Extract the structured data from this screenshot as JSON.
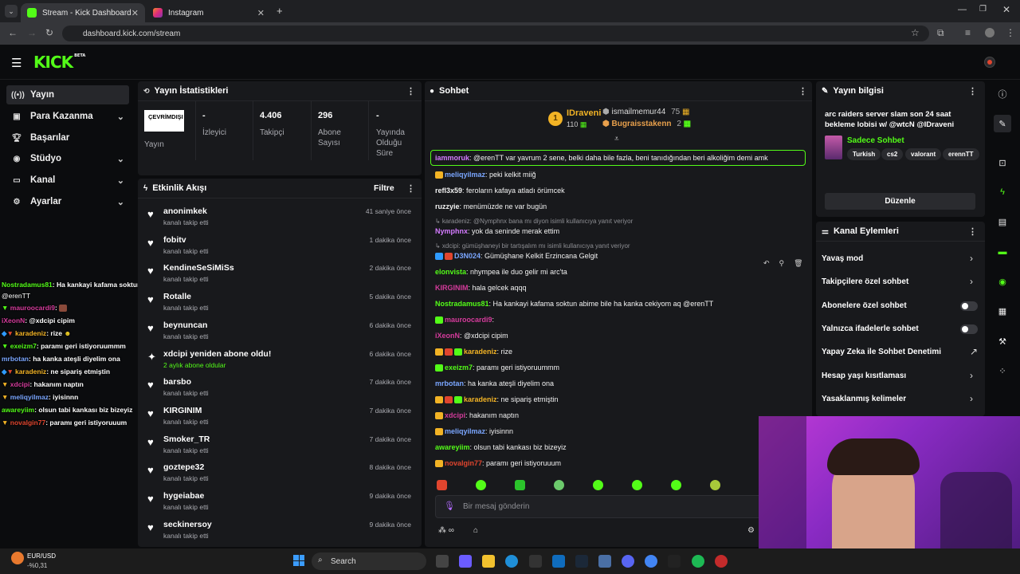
{
  "browser": {
    "tabs": [
      {
        "title": "Stream - Kick Dashboard",
        "fav_color": "#53fc18"
      },
      {
        "title": "Instagram",
        "fav_color": "#e1306c"
      }
    ],
    "url": "dashboard.kick.com/stream"
  },
  "app": {
    "logo": "KICK",
    "beta": "BETA"
  },
  "sidebar": {
    "items": [
      {
        "label": "Yayın",
        "icon": "broadcast-icon"
      },
      {
        "label": "Para Kazanma",
        "icon": "money-icon"
      },
      {
        "label": "Başarılar",
        "icon": "trophy-icon"
      },
      {
        "label": "Stüdyo",
        "icon": "studio-icon"
      },
      {
        "label": "Kanal",
        "icon": "channel-icon"
      },
      {
        "label": "Ayarlar",
        "icon": "gear-icon"
      }
    ]
  },
  "overlay_chat": [
    {
      "user": "Nostradamus81",
      "color": "#53fc18",
      "text": ": Ha kankayi kafama soktun abime bile ha kanka cekiyom aq"
    },
    {
      "user": "",
      "color": "#fff",
      "text": "@erenTT"
    },
    {
      "user": "mauroocardi9",
      "color": "#d43b9b",
      "text": ":"
    },
    {
      "user": "iXeonN",
      "color": "#d43b9b",
      "text": ": @xdcipi cipim"
    },
    {
      "user": "karadeniz",
      "color": "#f2b325",
      "text": ": rize"
    },
    {
      "user": "exeizm7",
      "color": "#53fc18",
      "text": ": paramı geri istiyoruummm"
    },
    {
      "user": "mrbotan",
      "color": "#7aa6ff",
      "text": ": ha kanka ateşli diyelim ona"
    },
    {
      "user": "karadeniz",
      "color": "#f2b325",
      "text": ": ne sipariş etmiştin"
    },
    {
      "user": "xdcipi",
      "color": "#d43b9b",
      "text": ": hakanım naptın"
    },
    {
      "user": "meliqyilmaz",
      "color": "#7aa6ff",
      "text": ": iyisinnn"
    },
    {
      "user": "awareyiim",
      "color": "#53fc18",
      "text": ": olsun tabi kankası biz bizeyiz"
    },
    {
      "user": "novalgin77",
      "color": "#e0452e",
      "text": ": paramı geri istiyoruuum"
    }
  ],
  "stats": {
    "title": "Yayın İstatistikleri",
    "status_badge": "ÇEVRİMDIŞI",
    "status_label": "Yayın",
    "items": [
      {
        "value": "-",
        "label": "İzleyici"
      },
      {
        "value": "4.406",
        "label": "Takipçi"
      },
      {
        "value": "296",
        "label": "Abone Sayısı"
      },
      {
        "value": "-",
        "label": "Yayında Olduğu Süre"
      }
    ]
  },
  "activity": {
    "title": "Etkinlik Akışı",
    "filter": "Filtre",
    "items": [
      {
        "name": "anonimkek",
        "sub": "kanalı takip etti",
        "time": "41 saniye önce",
        "icon": "heart-icon"
      },
      {
        "name": "fobitv",
        "sub": "kanalı takip etti",
        "time": "1 dakika önce",
        "icon": "heart-icon"
      },
      {
        "name": "KendineSeSiMiSs",
        "sub": "kanalı takip etti",
        "time": "2 dakika önce",
        "icon": "heart-icon"
      },
      {
        "name": "Rotalle",
        "sub": "kanalı takip etti",
        "time": "5 dakika önce",
        "icon": "heart-icon"
      },
      {
        "name": "beynuncan",
        "sub": "kanalı takip etti",
        "time": "6 dakika önce",
        "icon": "heart-icon"
      },
      {
        "name": "xdcipi yeniden abone oldu!",
        "sub": "2 aylık abone oldular",
        "time": "6 dakika önce",
        "icon": "sparkle-icon"
      },
      {
        "name": "barsbo",
        "sub": "kanalı takip etti",
        "time": "7 dakika önce",
        "icon": "heart-icon"
      },
      {
        "name": "KIRGINIM",
        "sub": "kanalı takip etti",
        "time": "7 dakika önce",
        "icon": "heart-icon"
      },
      {
        "name": "Smoker_TR",
        "sub": "kanalı takip etti",
        "time": "7 dakika önce",
        "icon": "heart-icon"
      },
      {
        "name": "goztepe32",
        "sub": "kanalı takip etti",
        "time": "8 dakika önce",
        "icon": "heart-icon"
      },
      {
        "name": "hygeiabae",
        "sub": "kanalı takip etti",
        "time": "9 dakika önce",
        "icon": "heart-icon"
      },
      {
        "name": "seckinersoy",
        "sub": "kanalı takip etti",
        "time": "9 dakika önce",
        "icon": "heart-icon"
      }
    ]
  },
  "chat": {
    "title": "Sohbet",
    "leaders": [
      {
        "rank": "1",
        "name": "IDraveni",
        "score": "110"
      },
      {
        "name": "ismailmemur44",
        "score": "75"
      },
      {
        "name": "Bugraisstakenn",
        "score": "2"
      }
    ],
    "messages": [
      {
        "user": "iammoruk",
        "color": "#d47bff",
        "text": ": @erenTT var yavrum 2 sene, belki daha bile fazla, beni tanıdığından beri alkoliğim demi amk"
      },
      {
        "user": "meliqyilmaz",
        "color": "#7aa6ff",
        "text": ": peki kelkit miiğ"
      },
      {
        "user": "refl3x59",
        "color": "#f2f2f2",
        "text": ": feroların kafaya atladı örümcek"
      },
      {
        "user": "ruzzyie",
        "color": "#f2f2f2",
        "text": ": menümüzde ne var bugün"
      },
      {
        "user": "Nymphnx",
        "color": "#d47bff",
        "text": ": yok da seninde merak ettim",
        "reply": "karadeniz: @Nymphnx bana mı diyon isimli kullanıcıya yanıt veriyor"
      },
      {
        "user": "D3N024",
        "color": "#7aa6ff",
        "text": ": Gümüşhane Kelkit Erzincana Gelgit",
        "reply": "xdcipi: gümüşhaneyi bir tartışalım mı isimli kullanıcıya yanıt veriyor"
      },
      {
        "user": "elonvista",
        "color": "#53fc18",
        "text": ": nhympea ile duo gelir mi arc'ta"
      },
      {
        "user": "KIRGINIM",
        "color": "#d43b9b",
        "text": ": hala gelcek aqqq"
      },
      {
        "user": "Nostradamus81",
        "color": "#53fc18",
        "text": ": Ha kankayi kafama soktun abime bile ha kanka cekiyom aq @erenTT"
      },
      {
        "user": "mauroocardi9",
        "color": "#d43b9b",
        "text": ":"
      },
      {
        "user": "iXeonN",
        "color": "#d43b9b",
        "text": ": @xdcipi cipim"
      },
      {
        "user": "karadeniz",
        "color": "#f2b325",
        "text": ": rize"
      },
      {
        "user": "exeizm7",
        "color": "#53fc18",
        "text": ": paramı geri istiyoruummm"
      },
      {
        "user": "mrbotan",
        "color": "#7aa6ff",
        "text": ": ha kanka ateşli diyelim ona"
      },
      {
        "user": "karadeniz",
        "color": "#f2b325",
        "text": ": ne sipariş etmiştin"
      },
      {
        "user": "xdcipi",
        "color": "#d43b9b",
        "text": ": hakanım naptın"
      },
      {
        "user": "meliqyilmaz",
        "color": "#7aa6ff",
        "text": ": iyisinnn"
      },
      {
        "user": "awareyiim",
        "color": "#53fc18",
        "text": ": olsun tabi kankası biz bizeyiz"
      },
      {
        "user": "novalgin77",
        "color": "#e0452e",
        "text": ": paramı geri istiyoruuum"
      }
    ],
    "input_placeholder": "Bir mesaj gönderin"
  },
  "info": {
    "title": "Yayın bilgisi",
    "stream_title": "arc raiders server slam son 24 saat bekleme lobisi w/ @wtcN @IDraveni",
    "category": "Sadece Sohbet",
    "tags": [
      "Turkish",
      "cs2",
      "valorant",
      "erennTT"
    ],
    "edit": "Düzenle"
  },
  "actions": {
    "title": "Kanal Eylemleri",
    "items": [
      {
        "label": "Yavaş mod",
        "control": "chevron"
      },
      {
        "label": "Takipçilere özel sohbet",
        "control": "chevron"
      },
      {
        "label": "Abonelere özel sohbet",
        "control": "toggle"
      },
      {
        "label": "Yalnızca ifadelerle sohbet",
        "control": "toggle"
      },
      {
        "label": "Yapay Zeka ile Sohbet Denetimi",
        "control": "external"
      },
      {
        "label": "Hesap yaşı kısıtlaması",
        "control": "chevron"
      },
      {
        "label": "Yasaklanmış kelimeler",
        "control": "chevron"
      }
    ]
  },
  "taskbar": {
    "stock_name": "EUR/USD",
    "stock_change": "-%0,31",
    "search": "Search"
  },
  "colors": {
    "accent": "#53fc18",
    "panel": "#18191c",
    "bg": "#0b0c0e"
  }
}
